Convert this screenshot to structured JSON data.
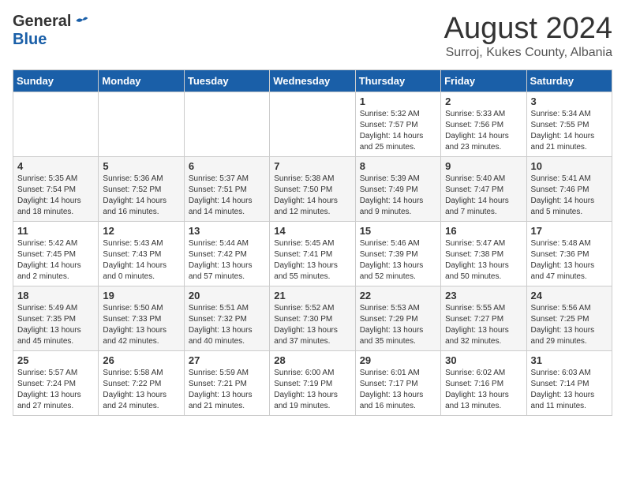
{
  "header": {
    "logo_general": "General",
    "logo_blue": "Blue",
    "title": "August 2024",
    "subtitle": "Surroj, Kukes County, Albania"
  },
  "weekdays": [
    "Sunday",
    "Monday",
    "Tuesday",
    "Wednesday",
    "Thursday",
    "Friday",
    "Saturday"
  ],
  "weeks": [
    [
      {
        "day": "",
        "info": ""
      },
      {
        "day": "",
        "info": ""
      },
      {
        "day": "",
        "info": ""
      },
      {
        "day": "",
        "info": ""
      },
      {
        "day": "1",
        "info": "Sunrise: 5:32 AM\nSunset: 7:57 PM\nDaylight: 14 hours\nand 25 minutes."
      },
      {
        "day": "2",
        "info": "Sunrise: 5:33 AM\nSunset: 7:56 PM\nDaylight: 14 hours\nand 23 minutes."
      },
      {
        "day": "3",
        "info": "Sunrise: 5:34 AM\nSunset: 7:55 PM\nDaylight: 14 hours\nand 21 minutes."
      }
    ],
    [
      {
        "day": "4",
        "info": "Sunrise: 5:35 AM\nSunset: 7:54 PM\nDaylight: 14 hours\nand 18 minutes."
      },
      {
        "day": "5",
        "info": "Sunrise: 5:36 AM\nSunset: 7:52 PM\nDaylight: 14 hours\nand 16 minutes."
      },
      {
        "day": "6",
        "info": "Sunrise: 5:37 AM\nSunset: 7:51 PM\nDaylight: 14 hours\nand 14 minutes."
      },
      {
        "day": "7",
        "info": "Sunrise: 5:38 AM\nSunset: 7:50 PM\nDaylight: 14 hours\nand 12 minutes."
      },
      {
        "day": "8",
        "info": "Sunrise: 5:39 AM\nSunset: 7:49 PM\nDaylight: 14 hours\nand 9 minutes."
      },
      {
        "day": "9",
        "info": "Sunrise: 5:40 AM\nSunset: 7:47 PM\nDaylight: 14 hours\nand 7 minutes."
      },
      {
        "day": "10",
        "info": "Sunrise: 5:41 AM\nSunset: 7:46 PM\nDaylight: 14 hours\nand 5 minutes."
      }
    ],
    [
      {
        "day": "11",
        "info": "Sunrise: 5:42 AM\nSunset: 7:45 PM\nDaylight: 14 hours\nand 2 minutes."
      },
      {
        "day": "12",
        "info": "Sunrise: 5:43 AM\nSunset: 7:43 PM\nDaylight: 14 hours\nand 0 minutes."
      },
      {
        "day": "13",
        "info": "Sunrise: 5:44 AM\nSunset: 7:42 PM\nDaylight: 13 hours\nand 57 minutes."
      },
      {
        "day": "14",
        "info": "Sunrise: 5:45 AM\nSunset: 7:41 PM\nDaylight: 13 hours\nand 55 minutes."
      },
      {
        "day": "15",
        "info": "Sunrise: 5:46 AM\nSunset: 7:39 PM\nDaylight: 13 hours\nand 52 minutes."
      },
      {
        "day": "16",
        "info": "Sunrise: 5:47 AM\nSunset: 7:38 PM\nDaylight: 13 hours\nand 50 minutes."
      },
      {
        "day": "17",
        "info": "Sunrise: 5:48 AM\nSunset: 7:36 PM\nDaylight: 13 hours\nand 47 minutes."
      }
    ],
    [
      {
        "day": "18",
        "info": "Sunrise: 5:49 AM\nSunset: 7:35 PM\nDaylight: 13 hours\nand 45 minutes."
      },
      {
        "day": "19",
        "info": "Sunrise: 5:50 AM\nSunset: 7:33 PM\nDaylight: 13 hours\nand 42 minutes."
      },
      {
        "day": "20",
        "info": "Sunrise: 5:51 AM\nSunset: 7:32 PM\nDaylight: 13 hours\nand 40 minutes."
      },
      {
        "day": "21",
        "info": "Sunrise: 5:52 AM\nSunset: 7:30 PM\nDaylight: 13 hours\nand 37 minutes."
      },
      {
        "day": "22",
        "info": "Sunrise: 5:53 AM\nSunset: 7:29 PM\nDaylight: 13 hours\nand 35 minutes."
      },
      {
        "day": "23",
        "info": "Sunrise: 5:55 AM\nSunset: 7:27 PM\nDaylight: 13 hours\nand 32 minutes."
      },
      {
        "day": "24",
        "info": "Sunrise: 5:56 AM\nSunset: 7:25 PM\nDaylight: 13 hours\nand 29 minutes."
      }
    ],
    [
      {
        "day": "25",
        "info": "Sunrise: 5:57 AM\nSunset: 7:24 PM\nDaylight: 13 hours\nand 27 minutes."
      },
      {
        "day": "26",
        "info": "Sunrise: 5:58 AM\nSunset: 7:22 PM\nDaylight: 13 hours\nand 24 minutes."
      },
      {
        "day": "27",
        "info": "Sunrise: 5:59 AM\nSunset: 7:21 PM\nDaylight: 13 hours\nand 21 minutes."
      },
      {
        "day": "28",
        "info": "Sunrise: 6:00 AM\nSunset: 7:19 PM\nDaylight: 13 hours\nand 19 minutes."
      },
      {
        "day": "29",
        "info": "Sunrise: 6:01 AM\nSunset: 7:17 PM\nDaylight: 13 hours\nand 16 minutes."
      },
      {
        "day": "30",
        "info": "Sunrise: 6:02 AM\nSunset: 7:16 PM\nDaylight: 13 hours\nand 13 minutes."
      },
      {
        "day": "31",
        "info": "Sunrise: 6:03 AM\nSunset: 7:14 PM\nDaylight: 13 hours\nand 11 minutes."
      }
    ]
  ]
}
